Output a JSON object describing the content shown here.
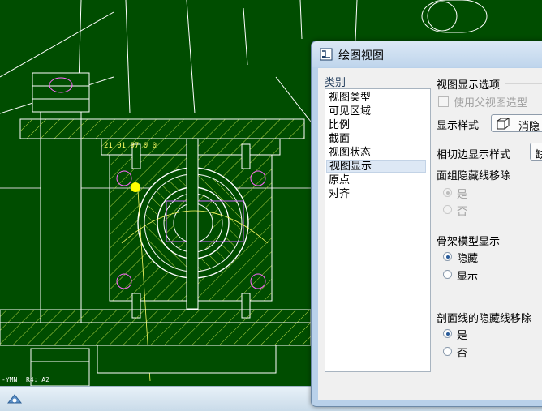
{
  "dialog": {
    "title": "绘图视图",
    "category_label": "类别",
    "categories": [
      "视图类型",
      "可见区域",
      "比例",
      "截面",
      "视图状态",
      "视图显示",
      "原点",
      "对齐"
    ],
    "selected_category": "视图显示",
    "group_title": "视图显示选项",
    "use_parent_label": "使用父视图造型",
    "display_style_label": "显示样式",
    "display_style_value": "消隐",
    "tangent_label": "相切边显示样式",
    "tangent_value": "缺",
    "face_group_label": "面组隐藏线移除",
    "face_group_yes": "是",
    "face_group_no": "否",
    "skeleton_label": "骨架模型显示",
    "skeleton_hide": "隐藏",
    "skeleton_show": "显示",
    "section_hidden_label": "剖面线的隐藏线移除",
    "section_yes": "是",
    "section_no": "否"
  },
  "cad": {
    "background_color": "#004d00",
    "hatch_color": "#c8e64b",
    "ruler_text": "21 01 97  0  0",
    "note_left": "-YMN",
    "note_right": "R4: A2"
  }
}
